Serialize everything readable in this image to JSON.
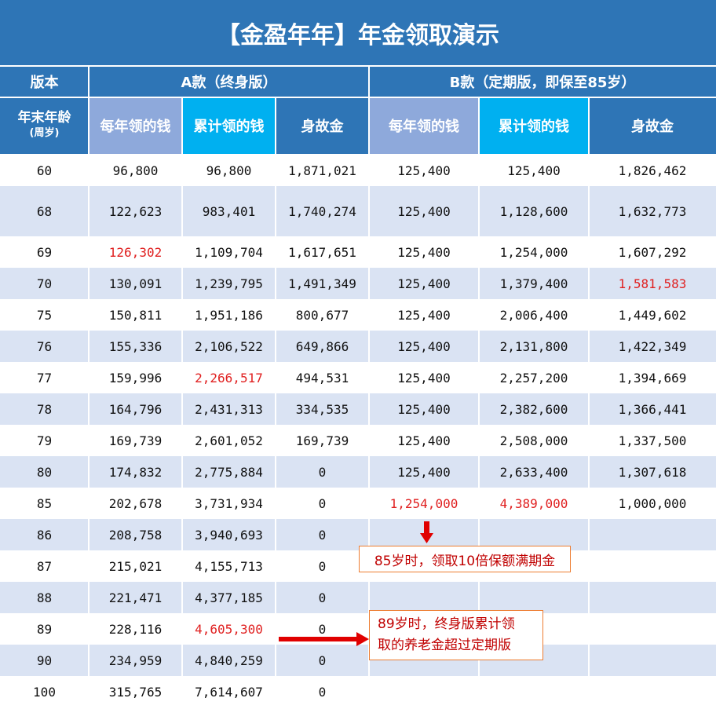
{
  "title": "【金盈年年】年金领取演示",
  "header": {
    "version_label": "版本",
    "a_label": "A款（终身版）",
    "b_label": "B款（定期版，即保至85岁）",
    "age_label": "年末年龄",
    "age_sub": "(周岁)",
    "col_annual": "每年领的钱",
    "col_cumulative": "累计领的钱",
    "col_death": "身故金"
  },
  "colors": {
    "header_blue": "#2E75B6",
    "lavender": "#8EA9DB",
    "cyan": "#00B0F0",
    "band": "#DAE3F3",
    "highlight_red": "#E02020",
    "callout_border": "#ED7D31"
  },
  "rows": [
    {
      "age": "60",
      "a_annual": "96,800",
      "a_cum": "96,800",
      "a_death": "1,871,021",
      "b_annual": "125,400",
      "b_cum": "125,400",
      "b_death": "1,826,462"
    },
    {
      "age": "68",
      "a_annual": "122,623",
      "a_cum": "983,401",
      "a_death": "1,740,274",
      "b_annual": "125,400",
      "b_cum": "1,128,600",
      "b_death": "1,632,773"
    },
    {
      "age": "69",
      "a_annual": "126,302",
      "a_cum": "1,109,704",
      "a_death": "1,617,651",
      "b_annual": "125,400",
      "b_cum": "1,254,000",
      "b_death": "1,607,292"
    },
    {
      "age": "70",
      "a_annual": "130,091",
      "a_cum": "1,239,795",
      "a_death": "1,491,349",
      "b_annual": "125,400",
      "b_cum": "1,379,400",
      "b_death": "1,581,583"
    },
    {
      "age": "75",
      "a_annual": "150,811",
      "a_cum": "1,951,186",
      "a_death": "800,677",
      "b_annual": "125,400",
      "b_cum": "2,006,400",
      "b_death": "1,449,602"
    },
    {
      "age": "76",
      "a_annual": "155,336",
      "a_cum": "2,106,522",
      "a_death": "649,866",
      "b_annual": "125,400",
      "b_cum": "2,131,800",
      "b_death": "1,422,349"
    },
    {
      "age": "77",
      "a_annual": "159,996",
      "a_cum": "2,266,517",
      "a_death": "494,531",
      "b_annual": "125,400",
      "b_cum": "2,257,200",
      "b_death": "1,394,669"
    },
    {
      "age": "78",
      "a_annual": "164,796",
      "a_cum": "2,431,313",
      "a_death": "334,535",
      "b_annual": "125,400",
      "b_cum": "2,382,600",
      "b_death": "1,366,441"
    },
    {
      "age": "79",
      "a_annual": "169,739",
      "a_cum": "2,601,052",
      "a_death": "169,739",
      "b_annual": "125,400",
      "b_cum": "2,508,000",
      "b_death": "1,337,500"
    },
    {
      "age": "80",
      "a_annual": "174,832",
      "a_cum": "2,775,884",
      "a_death": "0",
      "b_annual": "125,400",
      "b_cum": "2,633,400",
      "b_death": "1,307,618"
    },
    {
      "age": "85",
      "a_annual": "202,678",
      "a_cum": "3,731,934",
      "a_death": "0",
      "b_annual": "1,254,000",
      "b_cum": "4,389,000",
      "b_death": "1,000,000"
    },
    {
      "age": "86",
      "a_annual": "208,758",
      "a_cum": "3,940,693",
      "a_death": "0",
      "b_annual": "",
      "b_cum": "",
      "b_death": ""
    },
    {
      "age": "87",
      "a_annual": "215,021",
      "a_cum": "4,155,713",
      "a_death": "0",
      "b_annual": "",
      "b_cum": "",
      "b_death": ""
    },
    {
      "age": "88",
      "a_annual": "221,471",
      "a_cum": "4,377,185",
      "a_death": "0",
      "b_annual": "",
      "b_cum": "",
      "b_death": ""
    },
    {
      "age": "89",
      "a_annual": "228,116",
      "a_cum": "4,605,300",
      "a_death": "0",
      "b_annual": "",
      "b_cum": "",
      "b_death": ""
    },
    {
      "age": "90",
      "a_annual": "234,959",
      "a_cum": "4,840,259",
      "a_death": "0",
      "b_annual": "",
      "b_cum": "",
      "b_death": ""
    },
    {
      "age": "100",
      "a_annual": "315,765",
      "a_cum": "7,614,607",
      "a_death": "0",
      "b_annual": "",
      "b_cum": "",
      "b_death": ""
    }
  ],
  "highlights": [
    {
      "row": 2,
      "col": "a_annual"
    },
    {
      "row": 3,
      "col": "b_death"
    },
    {
      "row": 6,
      "col": "a_cum"
    },
    {
      "row": 10,
      "col": "b_annual"
    },
    {
      "row": 10,
      "col": "b_cum"
    },
    {
      "row": 14,
      "col": "a_cum"
    }
  ],
  "callouts": {
    "maturity": "85岁时，领取10倍保额满期金",
    "crossover_line1": "89岁时，终身版累计领",
    "crossover_line2": "取的养老金超过定期版"
  }
}
